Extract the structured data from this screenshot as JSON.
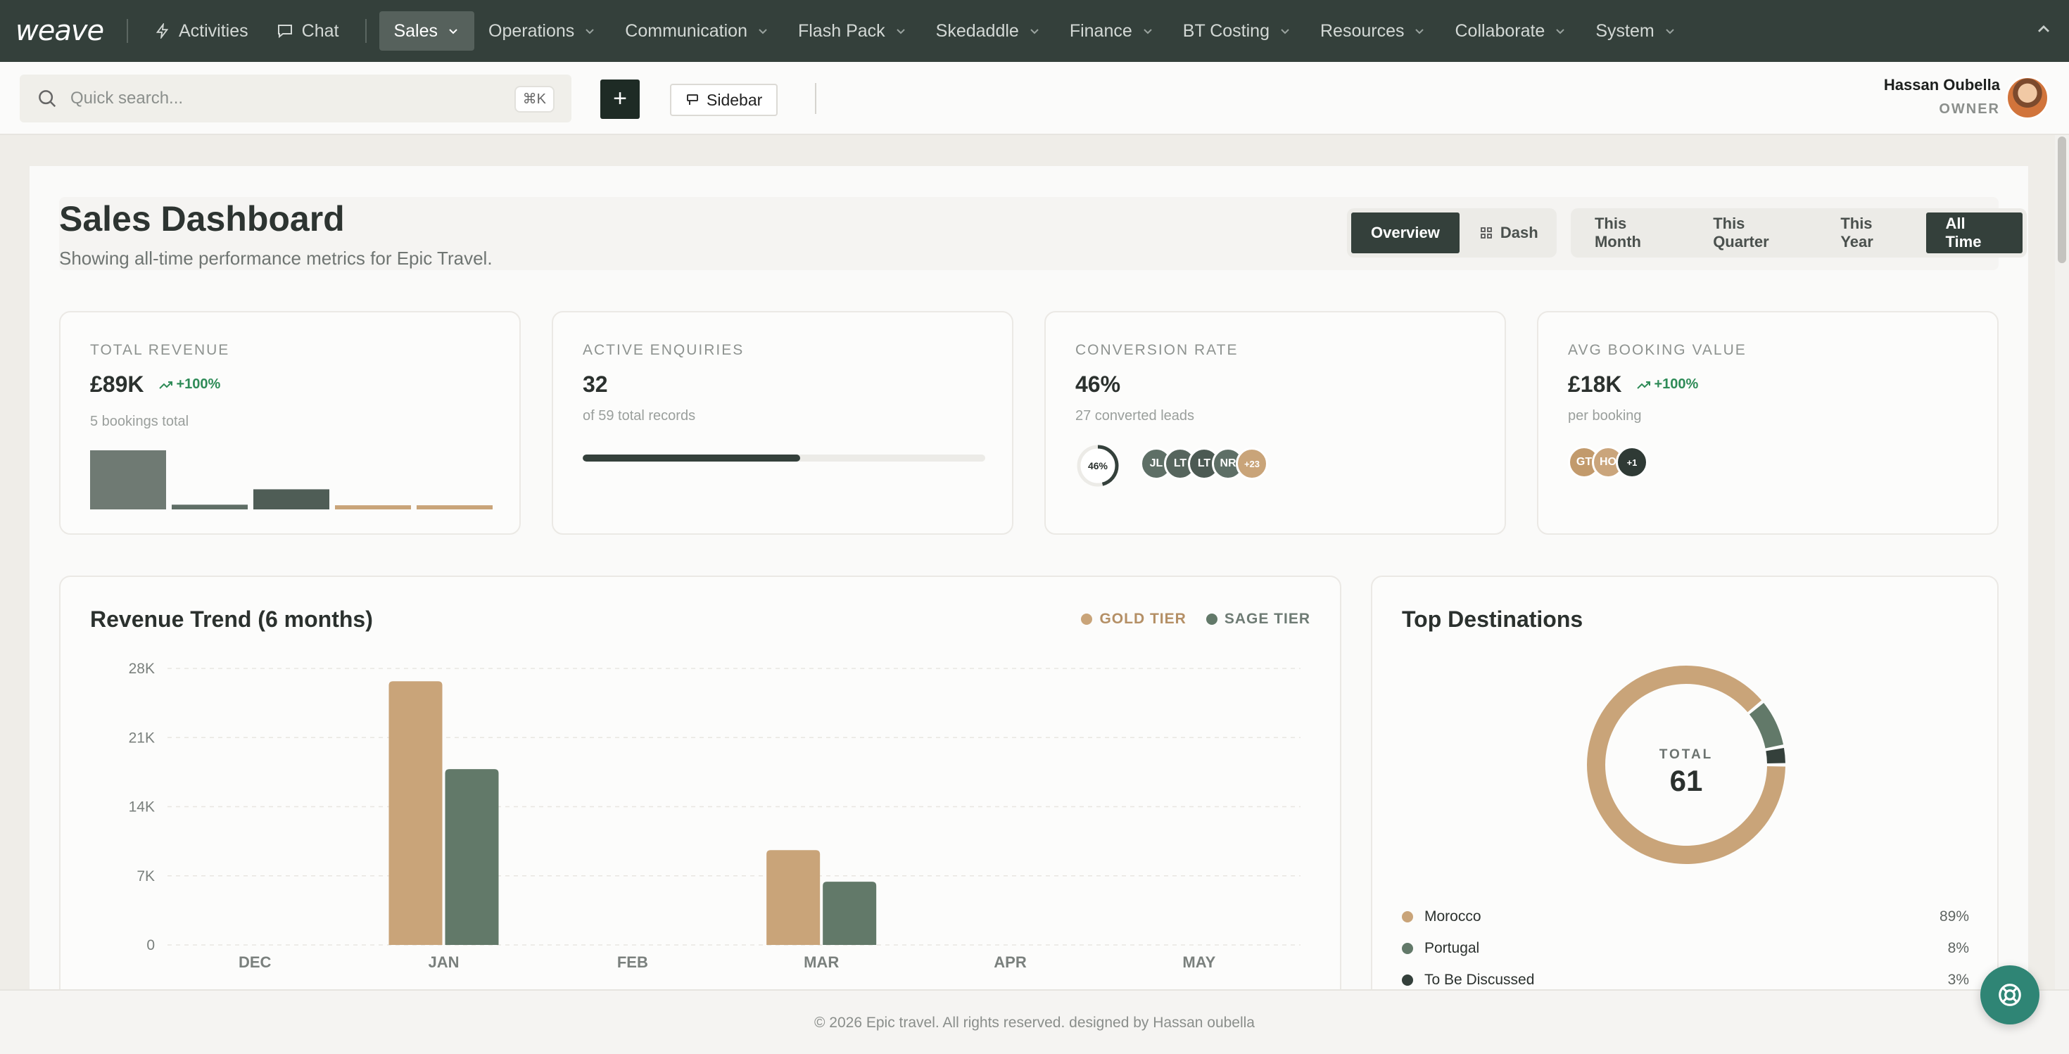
{
  "nav": {
    "logo": "weave",
    "items": [
      {
        "label": "Activities",
        "icon": "bolt-icon"
      },
      {
        "label": "Chat",
        "icon": "chat-icon"
      },
      {
        "label": "Sales",
        "active": true
      },
      {
        "label": "Operations"
      },
      {
        "label": "Communication"
      },
      {
        "label": "Flash Pack"
      },
      {
        "label": "Skedaddle"
      },
      {
        "label": "Finance"
      },
      {
        "label": "BT Costing"
      },
      {
        "label": "Resources"
      },
      {
        "label": "Collaborate"
      },
      {
        "label": "System"
      }
    ]
  },
  "toolbar": {
    "search_placeholder": "Quick search...",
    "search_shortcut": "⌘K",
    "add_label": "+",
    "sidebar_label": "Sidebar",
    "user_name": "Hassan Oubella",
    "user_role": "OWNER"
  },
  "page": {
    "title": "Sales Dashboard",
    "subtitle": "Showing all-time performance metrics for Epic Travel.",
    "view_tabs": [
      "Overview",
      "Dash"
    ],
    "active_view": "Overview",
    "ranges": [
      "This Month",
      "This Quarter",
      "This Year",
      "All Time"
    ],
    "active_range": "All Time"
  },
  "kpis": {
    "revenue": {
      "label": "TOTAL REVENUE",
      "value": "£89K",
      "trend": "+100%",
      "sub": "5 bookings total",
      "mini_bars": [
        {
          "value": 1.0,
          "color": "#6f7a73"
        },
        {
          "value": 0.08,
          "color": "#5f6e66"
        },
        {
          "value": 0.34,
          "color": "#4f5d56"
        },
        {
          "value": 0.07,
          "color": "#c9a479"
        },
        {
          "value": 0.07,
          "color": "#c9a479"
        }
      ]
    },
    "enquiries": {
      "label": "ACTIVE ENQUIRIES",
      "value": "32",
      "sub": "of 59 total records",
      "progress": 0.54
    },
    "conversion": {
      "label": "CONVERSION RATE",
      "value": "46%",
      "sub": "27 converted leads",
      "ring_label": "46%",
      "ring_value": 0.46,
      "avatars": [
        {
          "text": "JL",
          "color": "#5e6f66"
        },
        {
          "text": "LT",
          "color": "#56655d"
        },
        {
          "text": "LT",
          "color": "#4c5a53"
        },
        {
          "text": "NR",
          "color": "#5e6f66"
        },
        {
          "text": "+23",
          "color": "#c9a479"
        }
      ]
    },
    "avg": {
      "label": "AVG BOOKING VALUE",
      "value": "£18K",
      "trend": "+100%",
      "sub": "per booking",
      "avatars": [
        {
          "text": "GT",
          "color": "#c29a6c"
        },
        {
          "text": "HO",
          "color": "#caa57c"
        },
        {
          "text": "+1",
          "color": "#2f3a35"
        }
      ]
    }
  },
  "colors": {
    "gold": "#c9a479",
    "sage": "#627969",
    "dark": "#34403b",
    "accent_green": "#2e8b57"
  },
  "chart_data": [
    {
      "type": "bar",
      "title": "Revenue Trend (6 months)",
      "categories": [
        "DEC",
        "JAN",
        "FEB",
        "MAR",
        "APR",
        "MAY"
      ],
      "series": [
        {
          "name": "GOLD TIER",
          "values": [
            0,
            26700,
            0,
            9600,
            0,
            0
          ]
        },
        {
          "name": "SAGE TIER",
          "values": [
            0,
            17800,
            0,
            6400,
            0,
            0
          ]
        }
      ],
      "yticks": [
        "0",
        "7K",
        "14K",
        "21K",
        "28K"
      ],
      "ylim": [
        0,
        28000
      ],
      "grid": true,
      "legend": "top-right"
    },
    {
      "type": "pie",
      "title": "Top Destinations",
      "center_label": "TOTAL",
      "center_value": "61",
      "slices": [
        {
          "name": "Morocco",
          "value": 89,
          "label": "89%",
          "color": "#c9a479"
        },
        {
          "name": "Portugal",
          "value": 8,
          "label": "8%",
          "color": "#627969"
        },
        {
          "name": "To Be Discussed",
          "value": 3,
          "label": "3%",
          "color": "#34403b"
        }
      ]
    }
  ],
  "footer": {
    "text": "© 2026 Epic travel. All rights reserved. designed by Hassan oubella"
  }
}
